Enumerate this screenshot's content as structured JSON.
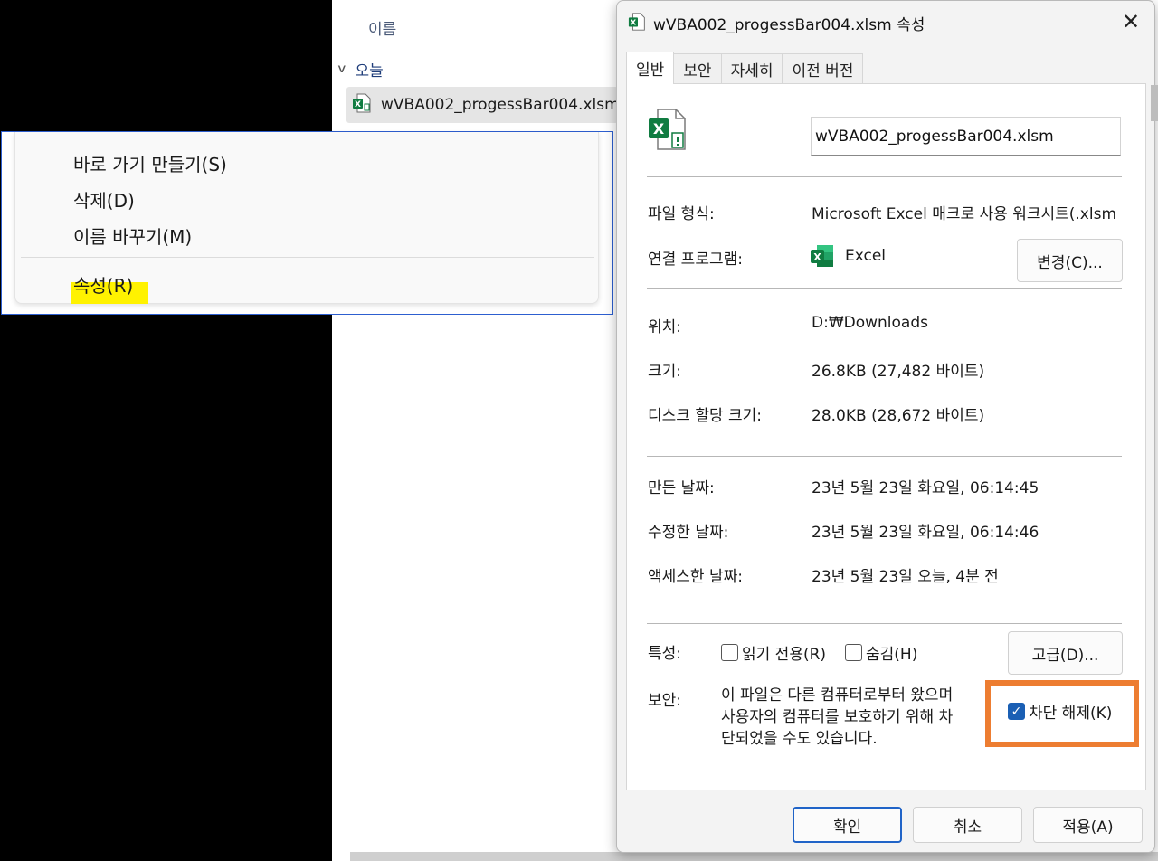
{
  "explorer": {
    "column_header": "이름",
    "group_label": "오늘",
    "file_name": "wVBA002_progessBar004.xlsm"
  },
  "context_menu": {
    "items": [
      {
        "label": "바로 가기 만들기(S)"
      },
      {
        "label": "삭제(D)"
      },
      {
        "label": "이름 바꾸기(M)"
      },
      {
        "label": "속성(R)"
      }
    ],
    "highlight_color": "#fff200"
  },
  "dialog": {
    "title": "wVBA002_progessBar004.xlsm 속성",
    "tabs": [
      "일반",
      "보안",
      "자세히",
      "이전 버전"
    ],
    "active_tab": "일반",
    "file_name_value": "wVBA002_progessBar004.xlsm",
    "file_type_label": "파일 형식:",
    "file_type_value": "Microsoft Excel 매크로 사용 워크시트(.xlsm",
    "open_with_label": "연결 프로그램:",
    "open_with_value": "Excel",
    "change_button": "변경(C)...",
    "location_label": "위치:",
    "location_value": "D:₩Downloads",
    "size_label": "크기:",
    "size_value": "26.8KB (27,482 바이트)",
    "disk_size_label": "디스크 할당 크기:",
    "disk_size_value": "28.0KB (28,672 바이트)",
    "created_label": "만든 날짜:",
    "created_value": "23년 5월 23일 화요일, 06:14:45",
    "modified_label": "수정한 날짜:",
    "modified_value": "23년 5월 23일 화요일, 06:14:46",
    "accessed_label": "액세스한 날짜:",
    "accessed_value": "23년 5월 23일 오늘, 4분 전",
    "attributes_label": "특성:",
    "readonly_label": "읽기 전용(R)",
    "readonly_checked": false,
    "hidden_label": "숨김(H)",
    "hidden_checked": false,
    "advanced_button": "고급(D)...",
    "security_label": "보안:",
    "security_text_lines": [
      "이 파일은 다른 컴퓨터로부터 왔으며",
      "사용자의 컴퓨터를 보호하기 위해 차",
      "단되었을 수도 있습니다."
    ],
    "unblock_label": "차단 해제(K)",
    "unblock_checked": true,
    "ok_button": "확인",
    "cancel_button": "취소",
    "apply_button": "적용(A)",
    "accent_color": "#1a5fb4",
    "callout_color": "#ed7d31",
    "excel_green": "#107c41"
  }
}
